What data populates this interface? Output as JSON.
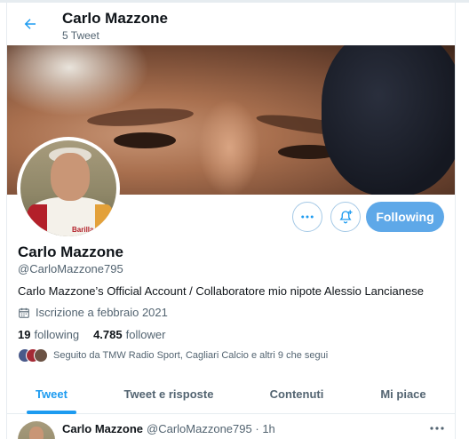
{
  "header": {
    "title": "Carlo Mazzone",
    "tweet_count": "5 Tweet"
  },
  "actions": {
    "follow_label": "Following"
  },
  "profile": {
    "name": "Carlo Mazzone",
    "handle": "@CarloMazzone795",
    "bio": "Carlo Mazzone’s Official Account / Collaboratore mio nipote Alessio Lancianese",
    "joined": "Iscrizione a febbraio 2021",
    "following_count": "19",
    "following_label": "following",
    "followers_count": "4.785",
    "followers_label": "follower",
    "followed_by": "Seguito da TMW Radio Sport, Cagliari Calcio e altri 9 che segui",
    "avatar_badge": "Barilla"
  },
  "tabs": [
    {
      "label": "Tweet",
      "active": true
    },
    {
      "label": "Tweet e risposte",
      "active": false
    },
    {
      "label": "Contenuti",
      "active": false
    },
    {
      "label": "Mi piace",
      "active": false
    }
  ],
  "tweet": {
    "name": "Carlo Mazzone",
    "handle": "@CarloMazzone795",
    "separator": "·",
    "time": "1h"
  },
  "colors": {
    "accent": "#1d9bf0",
    "follow_button": "#5ea8e8",
    "secondary_text": "#536471"
  },
  "icons": {
    "back": "arrow-left-icon",
    "more": "more-dots-icon",
    "notify": "bell-plus-icon",
    "calendar": "calendar-icon"
  }
}
